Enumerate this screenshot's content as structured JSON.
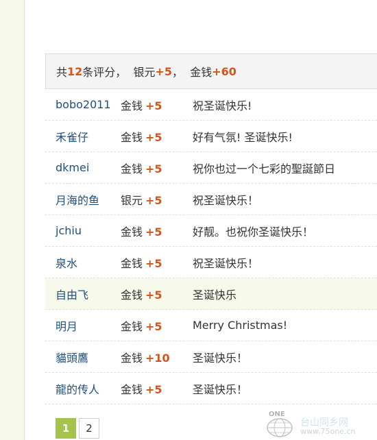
{
  "summary": {
    "prefix": "共",
    "count": "12",
    "mid": "条评分，  银元",
    "silver": "+5",
    "sep": "，  金钱",
    "gold": "+60"
  },
  "rows": [
    {
      "user": "bobo2011",
      "type": "金钱",
      "amount": "+5",
      "reason": "祝圣诞快乐!"
    },
    {
      "user": "禾雀仔",
      "type": "金钱",
      "amount": "+5",
      "reason": "好有气氛! 圣诞快乐!"
    },
    {
      "user": "dkmei",
      "type": "金钱",
      "amount": "+5",
      "reason": "祝你也过一个七彩的聖誕節日"
    },
    {
      "user": "月海的鱼",
      "type": "银元",
      "amount": "+5",
      "reason": "祝圣诞快乐！"
    },
    {
      "user": "jchiu",
      "type": "金钱",
      "amount": "+5",
      "reason": "好靓。也祝你圣诞快乐！"
    },
    {
      "user": "泉水",
      "type": "金钱",
      "amount": "+5",
      "reason": "祝圣诞快乐！"
    },
    {
      "user": "自由飞",
      "type": "金钱",
      "amount": "+5",
      "reason": "圣诞快乐"
    },
    {
      "user": "明月",
      "type": "金钱",
      "amount": "+5",
      "reason": "Merry Christmas!"
    },
    {
      "user": "貓頭鷹",
      "type": "金钱",
      "amount": "+10",
      "reason": "圣诞快乐！"
    },
    {
      "user": "龍的传人",
      "type": "金钱",
      "amount": "+5",
      "reason": "圣诞快乐！"
    }
  ],
  "pager": {
    "page1": "1",
    "page2": "2"
  },
  "watermark": {
    "logo": "ONE",
    "site": "台山同乡网",
    "url": "www.75one.cn"
  },
  "colors": {
    "highlight": "#d5541a",
    "username": "#1f4f7c",
    "current_page": "#a7c34e"
  }
}
